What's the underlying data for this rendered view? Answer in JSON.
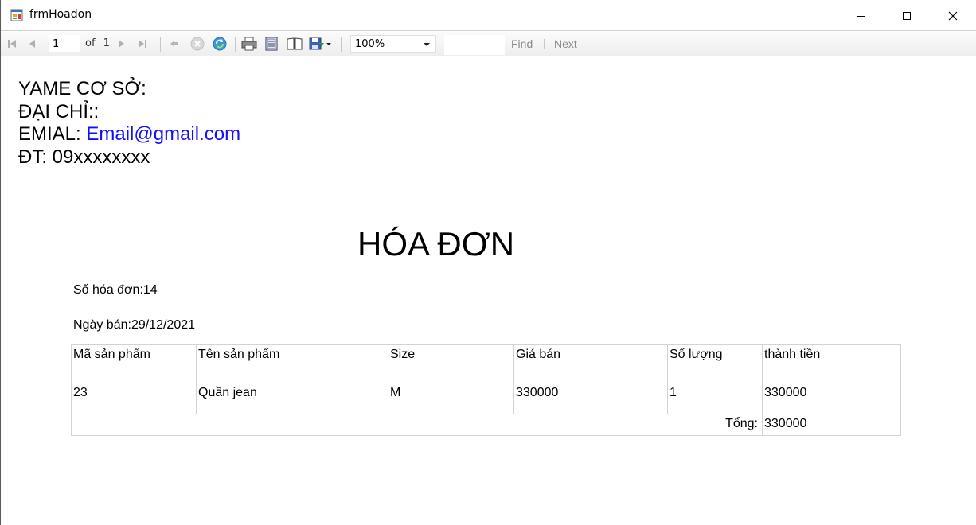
{
  "window": {
    "title": "frmHoadon"
  },
  "toolbar": {
    "page_current": "1",
    "page_of": "of",
    "page_total": "1",
    "zoom": "100%",
    "find_label": "Find",
    "next_label": "Next"
  },
  "report": {
    "shop_name": "YAME CƠ SỞ:",
    "address": "ĐẠI CHỈ::",
    "email_label": "EMIAL: ",
    "email_value": "Email@gmail.com",
    "phone": "ĐT: 09xxxxxxxx",
    "title": "HÓA ĐƠN",
    "invoice_no": "Số hóa đơn:14",
    "sale_date": "Ngày bán:29/12/2021",
    "columns": [
      "Mã sản phẩm",
      "Tên sản phẩm",
      "Size",
      "Giá bán",
      "Số lượng",
      "thành tiền"
    ],
    "rows": [
      [
        "23",
        "Quần jean",
        "M",
        "330000",
        "1",
        "330000"
      ]
    ],
    "total_label": "Tổng:",
    "total_value": "330000"
  },
  "colors": {
    "email": "#1010ff",
    "grid": "#d3d3d3"
  }
}
